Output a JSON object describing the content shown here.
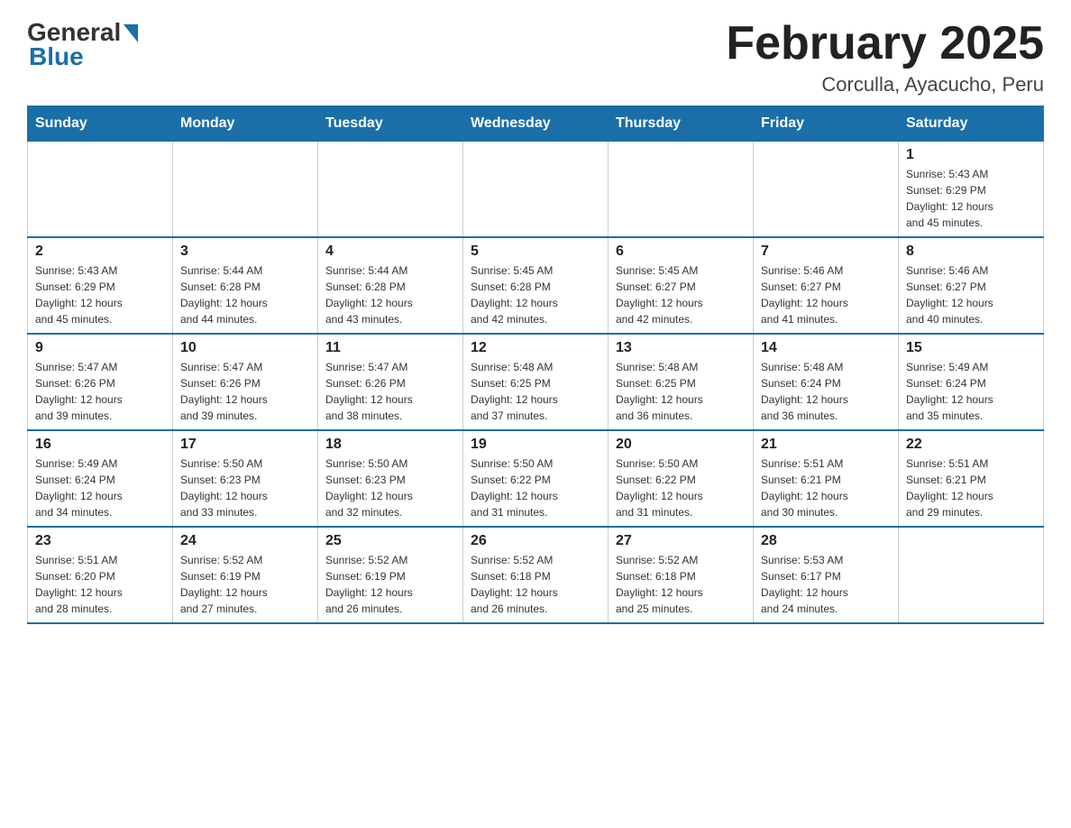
{
  "logo": {
    "general": "General",
    "blue": "Blue"
  },
  "title": "February 2025",
  "subtitle": "Corculla, Ayacucho, Peru",
  "days_header": [
    "Sunday",
    "Monday",
    "Tuesday",
    "Wednesday",
    "Thursday",
    "Friday",
    "Saturday"
  ],
  "weeks": [
    [
      {
        "num": "",
        "info": ""
      },
      {
        "num": "",
        "info": ""
      },
      {
        "num": "",
        "info": ""
      },
      {
        "num": "",
        "info": ""
      },
      {
        "num": "",
        "info": ""
      },
      {
        "num": "",
        "info": ""
      },
      {
        "num": "1",
        "info": "Sunrise: 5:43 AM\nSunset: 6:29 PM\nDaylight: 12 hours\nand 45 minutes."
      }
    ],
    [
      {
        "num": "2",
        "info": "Sunrise: 5:43 AM\nSunset: 6:29 PM\nDaylight: 12 hours\nand 45 minutes."
      },
      {
        "num": "3",
        "info": "Sunrise: 5:44 AM\nSunset: 6:28 PM\nDaylight: 12 hours\nand 44 minutes."
      },
      {
        "num": "4",
        "info": "Sunrise: 5:44 AM\nSunset: 6:28 PM\nDaylight: 12 hours\nand 43 minutes."
      },
      {
        "num": "5",
        "info": "Sunrise: 5:45 AM\nSunset: 6:28 PM\nDaylight: 12 hours\nand 42 minutes."
      },
      {
        "num": "6",
        "info": "Sunrise: 5:45 AM\nSunset: 6:27 PM\nDaylight: 12 hours\nand 42 minutes."
      },
      {
        "num": "7",
        "info": "Sunrise: 5:46 AM\nSunset: 6:27 PM\nDaylight: 12 hours\nand 41 minutes."
      },
      {
        "num": "8",
        "info": "Sunrise: 5:46 AM\nSunset: 6:27 PM\nDaylight: 12 hours\nand 40 minutes."
      }
    ],
    [
      {
        "num": "9",
        "info": "Sunrise: 5:47 AM\nSunset: 6:26 PM\nDaylight: 12 hours\nand 39 minutes."
      },
      {
        "num": "10",
        "info": "Sunrise: 5:47 AM\nSunset: 6:26 PM\nDaylight: 12 hours\nand 39 minutes."
      },
      {
        "num": "11",
        "info": "Sunrise: 5:47 AM\nSunset: 6:26 PM\nDaylight: 12 hours\nand 38 minutes."
      },
      {
        "num": "12",
        "info": "Sunrise: 5:48 AM\nSunset: 6:25 PM\nDaylight: 12 hours\nand 37 minutes."
      },
      {
        "num": "13",
        "info": "Sunrise: 5:48 AM\nSunset: 6:25 PM\nDaylight: 12 hours\nand 36 minutes."
      },
      {
        "num": "14",
        "info": "Sunrise: 5:48 AM\nSunset: 6:24 PM\nDaylight: 12 hours\nand 36 minutes."
      },
      {
        "num": "15",
        "info": "Sunrise: 5:49 AM\nSunset: 6:24 PM\nDaylight: 12 hours\nand 35 minutes."
      }
    ],
    [
      {
        "num": "16",
        "info": "Sunrise: 5:49 AM\nSunset: 6:24 PM\nDaylight: 12 hours\nand 34 minutes."
      },
      {
        "num": "17",
        "info": "Sunrise: 5:50 AM\nSunset: 6:23 PM\nDaylight: 12 hours\nand 33 minutes."
      },
      {
        "num": "18",
        "info": "Sunrise: 5:50 AM\nSunset: 6:23 PM\nDaylight: 12 hours\nand 32 minutes."
      },
      {
        "num": "19",
        "info": "Sunrise: 5:50 AM\nSunset: 6:22 PM\nDaylight: 12 hours\nand 31 minutes."
      },
      {
        "num": "20",
        "info": "Sunrise: 5:50 AM\nSunset: 6:22 PM\nDaylight: 12 hours\nand 31 minutes."
      },
      {
        "num": "21",
        "info": "Sunrise: 5:51 AM\nSunset: 6:21 PM\nDaylight: 12 hours\nand 30 minutes."
      },
      {
        "num": "22",
        "info": "Sunrise: 5:51 AM\nSunset: 6:21 PM\nDaylight: 12 hours\nand 29 minutes."
      }
    ],
    [
      {
        "num": "23",
        "info": "Sunrise: 5:51 AM\nSunset: 6:20 PM\nDaylight: 12 hours\nand 28 minutes."
      },
      {
        "num": "24",
        "info": "Sunrise: 5:52 AM\nSunset: 6:19 PM\nDaylight: 12 hours\nand 27 minutes."
      },
      {
        "num": "25",
        "info": "Sunrise: 5:52 AM\nSunset: 6:19 PM\nDaylight: 12 hours\nand 26 minutes."
      },
      {
        "num": "26",
        "info": "Sunrise: 5:52 AM\nSunset: 6:18 PM\nDaylight: 12 hours\nand 26 minutes."
      },
      {
        "num": "27",
        "info": "Sunrise: 5:52 AM\nSunset: 6:18 PM\nDaylight: 12 hours\nand 25 minutes."
      },
      {
        "num": "28",
        "info": "Sunrise: 5:53 AM\nSunset: 6:17 PM\nDaylight: 12 hours\nand 24 minutes."
      },
      {
        "num": "",
        "info": ""
      }
    ]
  ]
}
